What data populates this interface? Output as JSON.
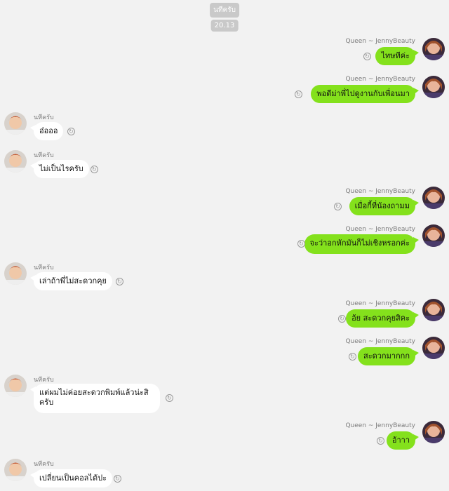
{
  "header": {
    "sender_chip": "นทีครับ",
    "time_chip": "20.13"
  },
  "names": {
    "queen": "Queen ~ JennyBeauty",
    "nati": "นทีครับ"
  },
  "icons": {
    "share": "share-icon",
    "avatar_out": "avatar-queen",
    "avatar_in": "avatar-nati"
  },
  "colors": {
    "outgoing_bubble": "#84e11c",
    "incoming_bubble": "#ffffff",
    "background": "#f2f2f2"
  },
  "messages": [
    {
      "dir": "out",
      "text": "ไทษทีค่ะ"
    },
    {
      "dir": "out",
      "text": "พอดีม่าพี่ไปดูงานกับเพื่อนมา"
    },
    {
      "dir": "in",
      "text": "อ๋อออ"
    },
    {
      "dir": "in",
      "text": "ไม่เป็นไรครับ"
    },
    {
      "dir": "out",
      "text": "เมื่อกี้ที่น้องถามม"
    },
    {
      "dir": "out",
      "text": "จะว่าอกหักมันก็ไม่เชิงหรอกค่ะ"
    },
    {
      "dir": "in",
      "text": "เล่าถ้าพี่ไม่สะดวกคุย"
    },
    {
      "dir": "out",
      "text": "อ้ย สะดวกคุยสิคะ"
    },
    {
      "dir": "out",
      "text": "สะดวกมากกก"
    },
    {
      "dir": "in",
      "text": "แต่ผมไม่ค่อยสะดวกพิมพ์แล้วน่ะสิครับ"
    },
    {
      "dir": "out",
      "text": "อ้าาา"
    },
    {
      "dir": "in",
      "text": "เปลี่ยนเป็นคอลได้ปะ"
    }
  ]
}
